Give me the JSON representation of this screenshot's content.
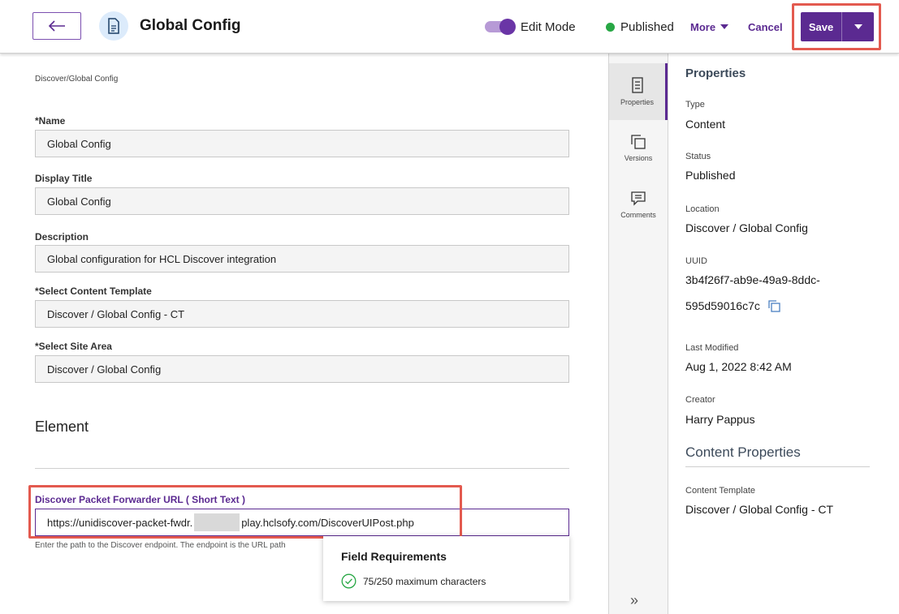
{
  "header": {
    "title": "Global Config",
    "edit_mode_label": "Edit Mode",
    "status_label": "Published",
    "more_label": "More",
    "cancel_label": "Cancel",
    "save_label": "Save"
  },
  "form": {
    "breadcrumb": "Discover/Global Config",
    "fields": [
      {
        "label": "*Name",
        "value": "Global Config"
      },
      {
        "label": "Display Title",
        "value": "Global Config"
      },
      {
        "label": "Description",
        "value": "Global configuration for HCL Discover integration"
      },
      {
        "label": "*Select Content Template",
        "value": "Discover / Global Config - CT"
      },
      {
        "label": "*Select Site Area",
        "value": "Discover / Global Config"
      }
    ],
    "element_section_title": "Element",
    "url_field": {
      "label": "Discover Packet Forwarder URL ( Short Text )",
      "value_start": "https://unidiscover-packet-fwdr.",
      "value_end": "play.hclsofy.com/DiscoverUIPost.php",
      "helper": "Enter the path to the Discover endpoint. The endpoint is the URL path"
    },
    "requirements": {
      "title": "Field Requirements",
      "text": "75/250 maximum characters"
    }
  },
  "rail": {
    "items": [
      {
        "label": "Properties"
      },
      {
        "label": "Versions"
      },
      {
        "label": "Comments"
      }
    ],
    "expand_glyph": "»"
  },
  "properties": {
    "title": "Properties",
    "type_label": "Type",
    "type_value": "Content",
    "status_label": "Status",
    "status_value": "Published",
    "location_label": "Location",
    "location_value": "Discover / Global Config",
    "uuid_label": "UUID",
    "uuid_line1": "3b4f26f7-ab9e-49a9-8ddc-",
    "uuid_line2": "595d59016c7c",
    "last_modified_label": "Last Modified",
    "last_modified_value": "Aug 1, 2022 8:42 AM",
    "creator_label": "Creator",
    "creator_value": "Harry Pappus",
    "content_properties_title": "Content Properties",
    "content_template_label": "Content Template",
    "content_template_value": "Discover / Global Config - CT"
  },
  "colors": {
    "accent": "#5b2a91",
    "highlight": "#e35a4f",
    "published": "#27a744"
  }
}
